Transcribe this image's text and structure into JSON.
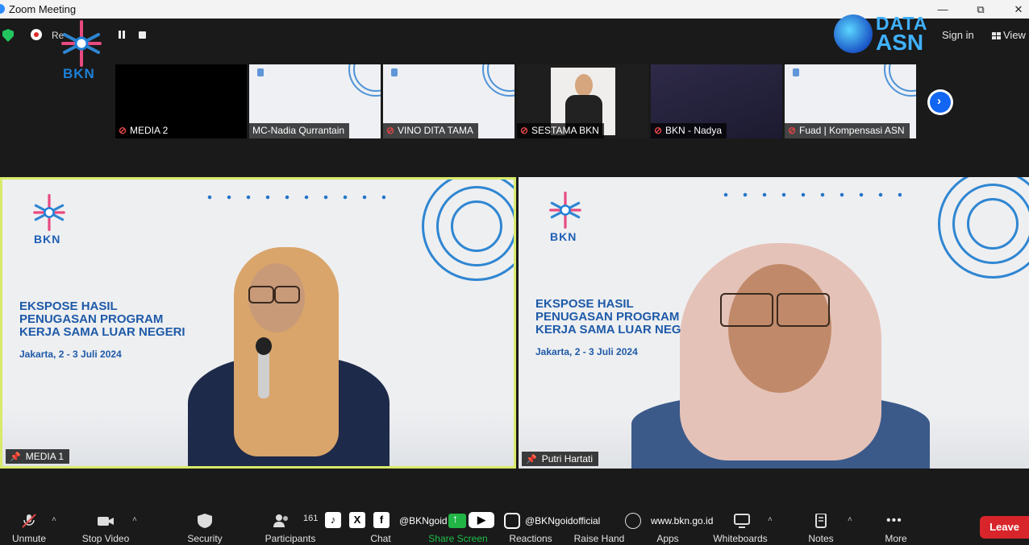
{
  "window": {
    "title": "Zoom Meeting",
    "minimize": "—",
    "restore": "⧉",
    "close": "✕"
  },
  "topbar": {
    "recording_label": "Re",
    "brand_logo": "BKN",
    "data_asn_top": "DATA",
    "data_asn_bottom": "ASN",
    "signin": "Sign in",
    "view": "View"
  },
  "gallery": [
    {
      "name": "MEDIA 2",
      "muted": true
    },
    {
      "name": "MC-Nadia Qurrantain",
      "muted": false
    },
    {
      "name": "VINO DITA TAMA",
      "muted": true
    },
    {
      "name": "SESTAMA BKN",
      "muted": true
    },
    {
      "name": "BKN - Nadya",
      "muted": true
    },
    {
      "name": "Fuad | Kompensasi ASN",
      "muted": true
    }
  ],
  "slide": {
    "logo": "BKN",
    "title_lines": [
      "EKSPOSE HASIL",
      "PENUGASAN PROGRAM",
      "KERJA SAMA LUAR NEGERI"
    ],
    "date": "Jakarta, 2 - 3 Juli 2024"
  },
  "speakers": [
    {
      "name": "MEDIA 1"
    },
    {
      "name": "Putri Hartati"
    }
  ],
  "toolbar": {
    "unmute": "Unmute",
    "stop_video": "Stop Video",
    "security": "Security",
    "participants": "Participants",
    "participants_count": "161",
    "chat": "Chat",
    "share_screen": "Share Screen",
    "reactions": "Reactions",
    "raise_hand": "Raise Hand",
    "apps": "Apps",
    "whiteboards": "Whiteboards",
    "notes": "Notes",
    "more": "More",
    "leave": "Leave"
  },
  "overlay": {
    "handle1": "@BKNgoid",
    "handle2": "@BKNgoidofficial",
    "website": "www.bkn.go.id"
  },
  "colors": {
    "accent_blue": "#1266f1",
    "leave_red": "#d8252b",
    "share_green": "#21b546",
    "active_speaker": "#d8ea6a"
  }
}
